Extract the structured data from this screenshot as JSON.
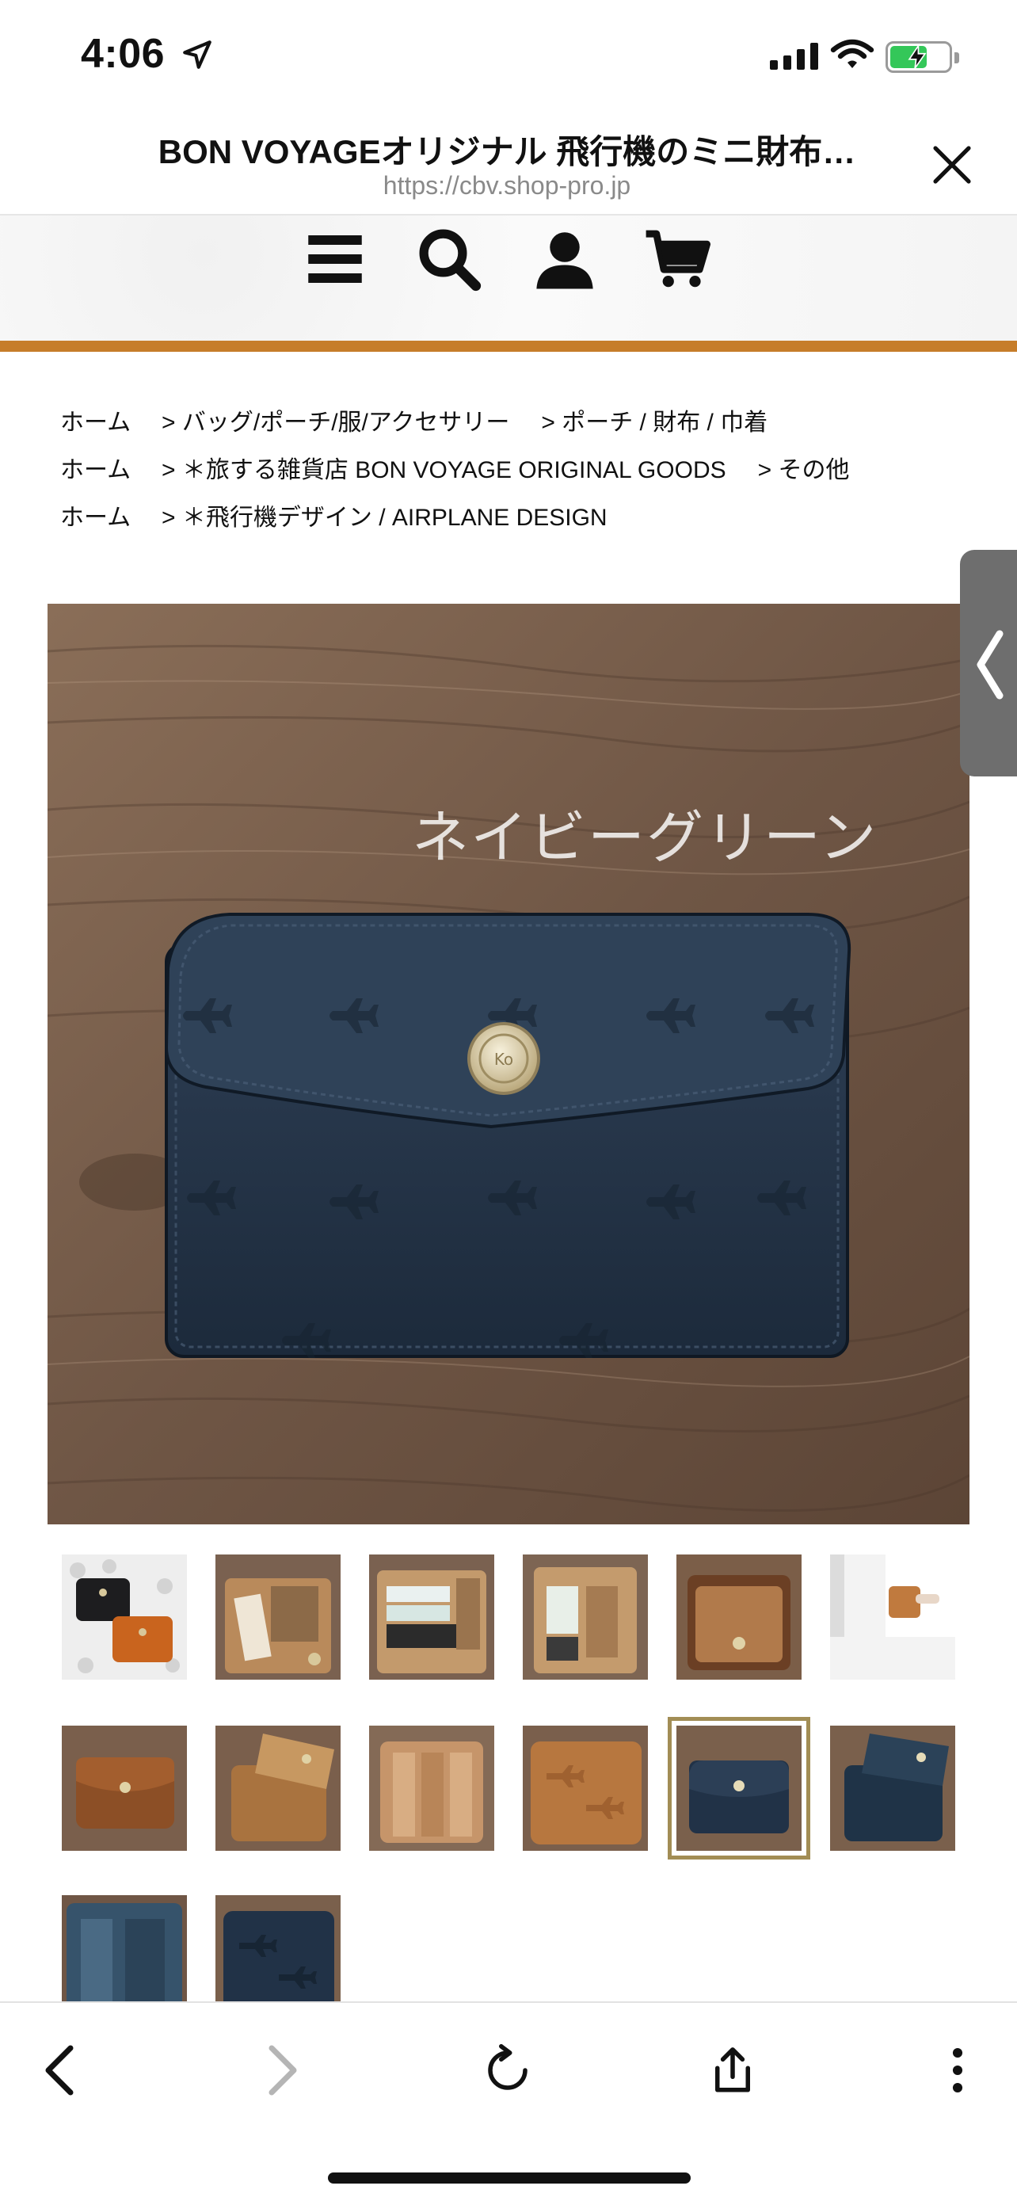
{
  "status_bar": {
    "time": "4:06",
    "icons": [
      "location-arrow-icon",
      "signal-icon",
      "wifi-icon",
      "battery-charging-icon"
    ]
  },
  "browser": {
    "page_title": "BON VOYAGEオリジナル 飛行機のミニ財布…",
    "url": "https://cbv.shop-pro.jp",
    "close_icon": "close-icon"
  },
  "site_header": {
    "icons": [
      "menu-icon",
      "search-icon",
      "account-icon",
      "cart-icon"
    ],
    "accent_color": "#c67d2a"
  },
  "breadcrumbs": [
    {
      "home": "ホーム",
      "segments": [
        "> バッグ/ポーチ/服/アクセサリー",
        "> ポーチ / 財布 / 巾着"
      ]
    },
    {
      "home": "ホーム",
      "segments": [
        "> ＊旅する雑貨店 BON VOYAGE ORIGINAL GOODS",
        "> その他"
      ]
    },
    {
      "home": "ホーム",
      "segments": [
        "> ＊飛行機デザイン / AIRPLANE DESIGN"
      ]
    }
  ],
  "product": {
    "main_image_caption": "ネイビーグリーン",
    "thumbnails": [
      {
        "variant": "black-orange"
      },
      {
        "variant": "tan-open-cards"
      },
      {
        "variant": "tan-open-cash"
      },
      {
        "variant": "tan-open-coins"
      },
      {
        "variant": "tan-interior"
      },
      {
        "variant": "worn-on-person"
      },
      {
        "variant": "brown-closed"
      },
      {
        "variant": "tan-open"
      },
      {
        "variant": "tan-inside-pockets"
      },
      {
        "variant": "tan-embossed"
      },
      {
        "variant": "navy-green",
        "selected": true
      },
      {
        "variant": "navy-open"
      },
      {
        "variant": "navy-pockets"
      },
      {
        "variant": "navy-embossed"
      }
    ]
  },
  "toolbar": {
    "buttons": [
      "back-icon",
      "forward-icon",
      "reload-icon",
      "share-icon",
      "more-icon"
    ]
  }
}
